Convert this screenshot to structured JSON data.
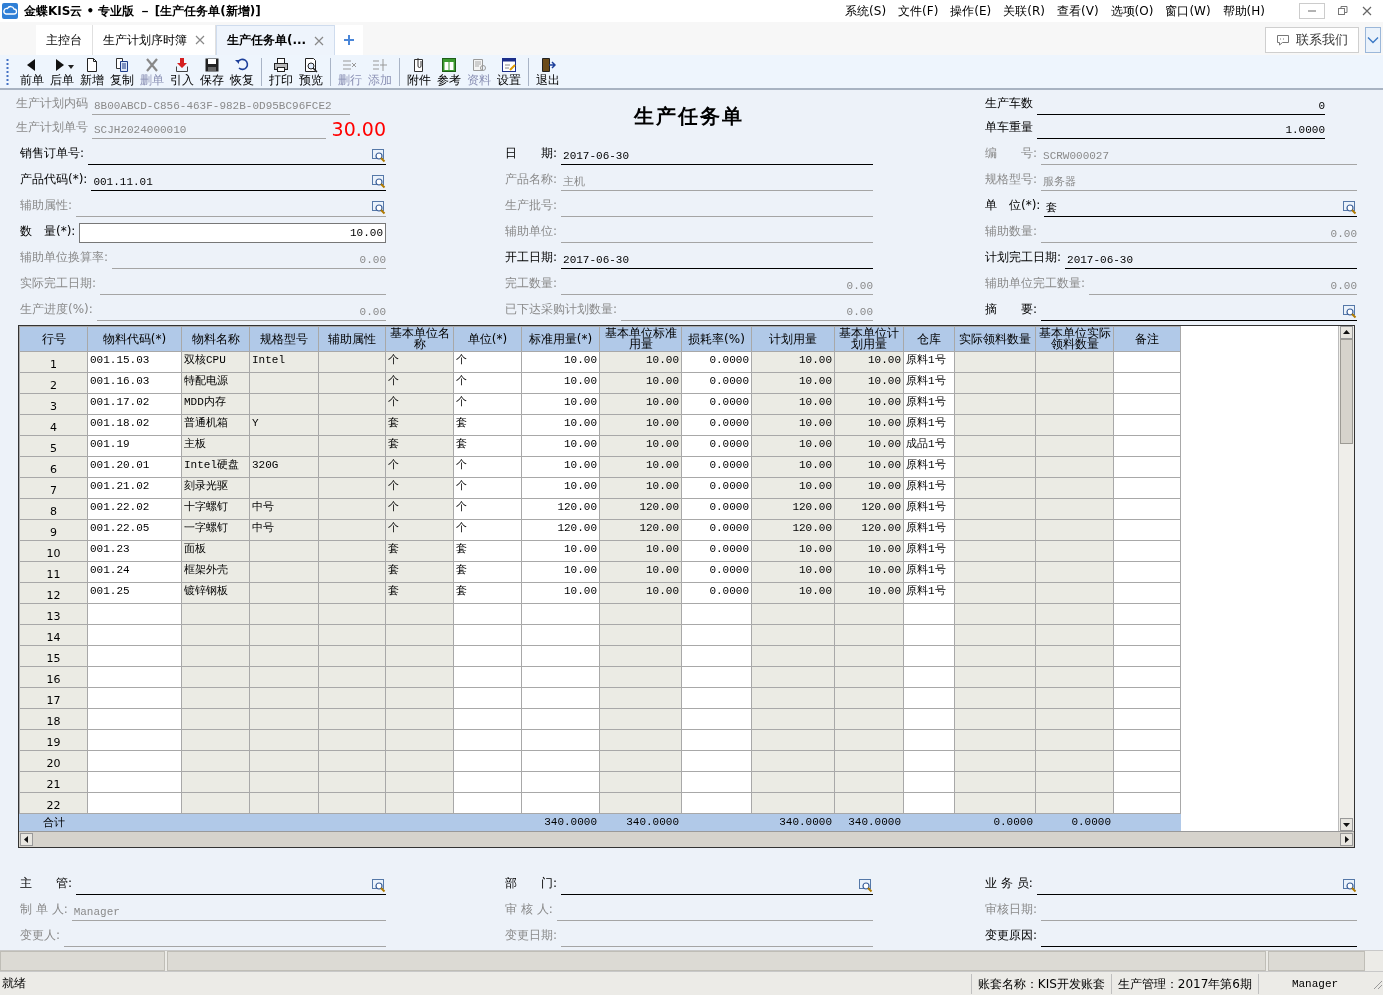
{
  "window": {
    "title": "金蝶KIS云 • 专业版 － [生产任务单(新增)]",
    "menus": [
      "系统(S)",
      "文件(F)",
      "操作(E)",
      "关联(R)",
      "查看(V)",
      "选项(O)",
      "窗口(W)",
      "帮助(H)"
    ]
  },
  "tabs": [
    {
      "label": "主控台",
      "selected": false,
      "closable": false
    },
    {
      "label": "生产计划序时簿",
      "selected": false,
      "closable": true
    },
    {
      "label": "生产任务单(...",
      "selected": true,
      "closable": true
    }
  ],
  "contact_button": "联系我们",
  "toolbar": [
    {
      "kind": "button",
      "label": "前单",
      "disabled": false
    },
    {
      "kind": "button",
      "label": "后单",
      "disabled": false,
      "menu": true
    },
    {
      "kind": "button",
      "label": "新增",
      "disabled": false
    },
    {
      "kind": "button",
      "label": "复制",
      "disabled": false
    },
    {
      "kind": "button",
      "label": "删单",
      "disabled": true
    },
    {
      "kind": "button",
      "label": "引入",
      "disabled": false
    },
    {
      "kind": "button",
      "label": "保存",
      "disabled": false
    },
    {
      "kind": "button",
      "label": "恢复",
      "disabled": false
    },
    {
      "kind": "separator"
    },
    {
      "kind": "button",
      "label": "打印",
      "disabled": false
    },
    {
      "kind": "button",
      "label": "预览",
      "disabled": false
    },
    {
      "kind": "separator"
    },
    {
      "kind": "button",
      "label": "删行",
      "disabled": true
    },
    {
      "kind": "button",
      "label": "添加",
      "disabled": true
    },
    {
      "kind": "separator"
    },
    {
      "kind": "button",
      "label": "附件",
      "disabled": false
    },
    {
      "kind": "button",
      "label": "参考",
      "disabled": false
    },
    {
      "kind": "button",
      "label": "资料",
      "disabled": true
    },
    {
      "kind": "button",
      "label": "设置",
      "disabled": false
    },
    {
      "kind": "separator"
    },
    {
      "kind": "button",
      "label": "退出",
      "disabled": false
    }
  ],
  "form": {
    "title": "生产任务单",
    "amount": "30.00",
    "header_left": [
      {
        "label": "生产计划内码",
        "value": "8B00ABCD-C856-463F-982B-0D95BC96FCE2",
        "kind": "text",
        "disabled": true,
        "lookup": false
      },
      {
        "label": "生产计划单号",
        "value": "SCJH2024000010",
        "kind": "text",
        "disabled": true,
        "lookup": false
      }
    ],
    "header_right": [
      {
        "label": "生产车数",
        "value": "0",
        "kind": "number",
        "disabled": false,
        "lookup": false
      },
      {
        "label": "单车重量",
        "value": "1.0000",
        "kind": "number",
        "disabled": false,
        "lookup": false
      }
    ],
    "left": [
      {
        "label": "销售订单号:",
        "kind": "text",
        "disabled": false,
        "lookup": true
      },
      {
        "label": "产品代码(*):",
        "value": "001.11.01",
        "kind": "text",
        "disabled": false,
        "lookup": true
      },
      {
        "label": "辅助属性:",
        "kind": "text",
        "disabled": true,
        "lookup": true
      },
      {
        "label": "数　量(*):",
        "value": "10.00",
        "kind": "box",
        "disabled": false,
        "lookup": false
      },
      {
        "label": "辅助单位换算率:",
        "value": "0.00",
        "kind": "number",
        "disabled": true,
        "lookup": false
      },
      {
        "label": "实际完工日期:",
        "kind": "text",
        "disabled": true,
        "lookup": false
      },
      {
        "label": "生产进度(%):",
        "value": "0.00",
        "kind": "number",
        "disabled": true,
        "lookup": false
      }
    ],
    "middle": [
      {
        "label": "日　　期:",
        "value": "2017-06-30",
        "kind": "text",
        "disabled": false,
        "lookup": false
      },
      {
        "label": "产品名称:",
        "value": "主机",
        "kind": "text",
        "disabled": true,
        "lookup": false
      },
      {
        "label": "生产批号:",
        "kind": "text",
        "disabled": true,
        "lookup": false
      },
      {
        "label": "辅助单位:",
        "kind": "text",
        "disabled": true,
        "lookup": false
      },
      {
        "label": "开工日期:",
        "value": "2017-06-30",
        "kind": "text",
        "disabled": false,
        "lookup": false
      },
      {
        "label": "完工数量:",
        "value": "0.00",
        "kind": "number",
        "disabled": true,
        "lookup": false
      },
      {
        "label": "已下达采购计划数量:",
        "value": "0.00",
        "kind": "number",
        "disabled": true,
        "lookup": false
      }
    ],
    "right": [
      {
        "label": "编　　号:",
        "value": "SCRW000027",
        "kind": "text",
        "disabled": true,
        "lookup": false
      },
      {
        "label": "规格型号:",
        "value": "服务器",
        "kind": "text",
        "disabled": true,
        "lookup": false
      },
      {
        "label": "单　位(*):",
        "value": "套",
        "kind": "text",
        "disabled": false,
        "lookup": true
      },
      {
        "label": "辅助数量:",
        "value": "0.00",
        "kind": "number",
        "disabled": true,
        "lookup": false
      },
      {
        "label": "计划完工日期:",
        "value": "2017-06-30",
        "kind": "text",
        "disabled": false,
        "lookup": false
      },
      {
        "label": "辅助单位完工数量:",
        "value": "0.00",
        "kind": "number",
        "disabled": true,
        "lookup": false
      },
      {
        "label": "摘　　要:",
        "kind": "text",
        "disabled": false,
        "lookup": true
      }
    ]
  },
  "table": {
    "columns": [
      {
        "title": "行号",
        "kind": "rownum",
        "locked": true,
        "total": "合计"
      },
      {
        "title": "物料代码(*)",
        "kind": "text",
        "locked": false
      },
      {
        "title": "物料名称",
        "kind": "text",
        "locked": true
      },
      {
        "title": "规格型号",
        "kind": "text",
        "locked": true
      },
      {
        "title": "辅助属性",
        "kind": "text",
        "locked": true
      },
      {
        "title": "基本单位名称",
        "kind": "text",
        "locked": true
      },
      {
        "title": "单位(*)",
        "kind": "text",
        "locked": false
      },
      {
        "title": "标准用量(*)",
        "kind": "number",
        "locked": false,
        "total": "340.0000"
      },
      {
        "title": "基本单位标准用量",
        "kind": "number",
        "locked": true,
        "total": "340.0000"
      },
      {
        "title": "损耗率(%)",
        "kind": "number",
        "locked": false
      },
      {
        "title": "计划用量",
        "kind": "number",
        "locked": true,
        "total": "340.0000"
      },
      {
        "title": "基本单位计划用量",
        "kind": "number",
        "locked": true,
        "total": "340.0000"
      },
      {
        "title": "仓库",
        "kind": "text",
        "locked": false
      },
      {
        "title": "实际领料数量",
        "kind": "number",
        "locked": true,
        "total": "0.0000"
      },
      {
        "title": "基本单位实际领料数量",
        "kind": "number",
        "locked": true,
        "total": "0.0000"
      },
      {
        "title": "备注",
        "kind": "text",
        "locked": false
      }
    ],
    "rows": [
      [
        "1",
        "001.15.03",
        "双核CPU",
        "Intel",
        null,
        "个",
        "个",
        "10.00",
        "10.00",
        "0.0000",
        "10.00",
        "10.00",
        "原料1号"
      ],
      [
        "2",
        "001.16.03",
        "特配电源",
        null,
        null,
        "个",
        "个",
        "10.00",
        "10.00",
        "0.0000",
        "10.00",
        "10.00",
        "原料1号"
      ],
      [
        "3",
        "001.17.02",
        "MDD内存",
        null,
        null,
        "个",
        "个",
        "10.00",
        "10.00",
        "0.0000",
        "10.00",
        "10.00",
        "原料1号"
      ],
      [
        "4",
        "001.18.02",
        "普通机箱",
        "Y",
        null,
        "套",
        "套",
        "10.00",
        "10.00",
        "0.0000",
        "10.00",
        "10.00",
        "原料1号"
      ],
      [
        "5",
        "001.19",
        "主板",
        null,
        null,
        "套",
        "套",
        "10.00",
        "10.00",
        "0.0000",
        "10.00",
        "10.00",
        "成品1号"
      ],
      [
        "6",
        "001.20.01",
        "Intel硬盘",
        "320G",
        null,
        "个",
        "个",
        "10.00",
        "10.00",
        "0.0000",
        "10.00",
        "10.00",
        "原料1号"
      ],
      [
        "7",
        "001.21.02",
        "刻录光驱",
        null,
        null,
        "个",
        "个",
        "10.00",
        "10.00",
        "0.0000",
        "10.00",
        "10.00",
        "原料1号"
      ],
      [
        "8",
        "001.22.02",
        "十字螺钉",
        "中号",
        null,
        "个",
        "个",
        "120.00",
        "120.00",
        "0.0000",
        "120.00",
        "120.00",
        "原料1号"
      ],
      [
        "9",
        "001.22.05",
        "一字螺钉",
        "中号",
        null,
        "个",
        "个",
        "120.00",
        "120.00",
        "0.0000",
        "120.00",
        "120.00",
        "原料1号"
      ],
      [
        "10",
        "001.23",
        "面板",
        null,
        null,
        "套",
        "套",
        "10.00",
        "10.00",
        "0.0000",
        "10.00",
        "10.00",
        "原料1号"
      ],
      [
        "11",
        "001.24",
        "框架外壳",
        null,
        null,
        "套",
        "套",
        "10.00",
        "10.00",
        "0.0000",
        "10.00",
        "10.00",
        "原料1号"
      ],
      [
        "12",
        "001.25",
        "镀锌钢板",
        null,
        null,
        "套",
        "套",
        "10.00",
        "10.00",
        "0.0000",
        "10.00",
        "10.00",
        "原料1号"
      ],
      [
        "13"
      ],
      [
        "14"
      ],
      [
        "15"
      ],
      [
        "16"
      ],
      [
        "17"
      ],
      [
        "18"
      ],
      [
        "19"
      ],
      [
        "20"
      ],
      [
        "21"
      ],
      [
        "22"
      ]
    ]
  },
  "footer": {
    "left": [
      {
        "label": "主　　管:",
        "kind": "text",
        "disabled": false,
        "lookup": true
      },
      {
        "label": "制 单 人:",
        "value": "Manager",
        "kind": "text",
        "disabled": true,
        "lookup": false
      },
      {
        "label": "变更人:",
        "kind": "text",
        "disabled": true,
        "lookup": false
      }
    ],
    "middle": [
      {
        "label": "部　　门:",
        "kind": "text",
        "disabled": false,
        "lookup": true
      },
      {
        "label": "审 核 人:",
        "kind": "text",
        "disabled": true,
        "lookup": false
      },
      {
        "label": "变更日期:",
        "kind": "text",
        "disabled": true,
        "lookup": false
      }
    ],
    "right": [
      {
        "label": "业 务 员:",
        "kind": "text",
        "disabled": false,
        "lookup": true
      },
      {
        "label": "审核日期:",
        "kind": "text",
        "disabled": true,
        "lookup": false
      },
      {
        "label": "变更原因:",
        "kind": "text",
        "disabled": false,
        "lookup": false
      }
    ]
  },
  "status_bar": {
    "message": "就绪",
    "account": "账套名称：KIS开发账套",
    "period": "生产管理：2017年第6期",
    "user": "Manager"
  }
}
